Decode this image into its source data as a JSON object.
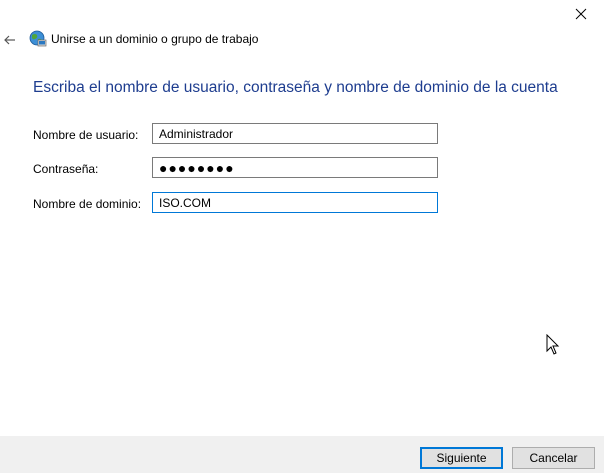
{
  "window": {
    "title": "Unirse a un dominio o grupo de trabajo",
    "icons": {
      "back": "back-arrow-icon",
      "close": "close-icon",
      "wizard": "network-globe-icon"
    }
  },
  "main": {
    "instruction": "Escriba el nombre de usuario, contraseña y nombre de dominio de la cuenta",
    "fields": {
      "username": {
        "label": "Nombre de usuario:",
        "value": "Administrador"
      },
      "password": {
        "label": "Contraseña:",
        "value": "●●●●●●●●"
      },
      "domain": {
        "label": "Nombre de dominio:",
        "value": "ISO.COM"
      }
    }
  },
  "footer": {
    "next_label": "Siguiente",
    "cancel_label": "Cancelar"
  },
  "colors": {
    "instruction": "#1e3d8f",
    "focus_border": "#0078d7",
    "footer_bg": "#f0f0f0"
  }
}
